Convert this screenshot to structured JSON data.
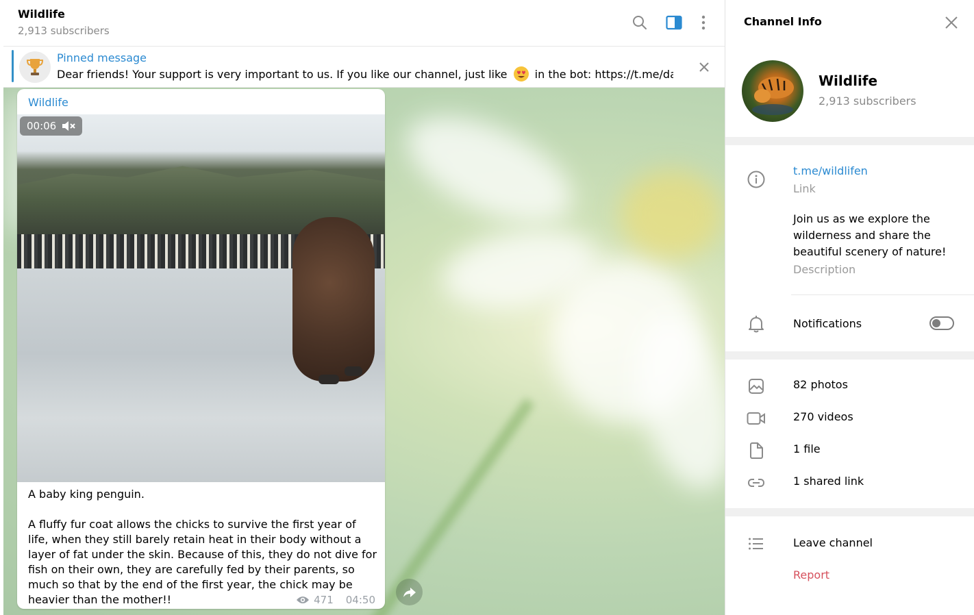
{
  "chat": {
    "title": "Wildlife",
    "subtitle": "2,913 subscribers"
  },
  "pinned": {
    "title": "Pinned message",
    "text_before": "Dear friends! Your support is very important to us.  If you like our channel, just like ",
    "text_after": " in the bot: https://t.me/dailych…"
  },
  "message": {
    "author": "Wildlife",
    "video_duration": "00:06",
    "text": "A baby king penguin.\n\nA fluffy fur coat allows the chicks to survive the first year of life, when they still barely retain heat in their body without a layer of fat under the skin. Because of this, they do not dive for fish on their own, they are carefully fed by their parents, so much so that by the end of the first year, the chick may be heavier than the mother!!",
    "views": "471",
    "time": "04:50"
  },
  "info": {
    "title": "Channel Info",
    "name": "Wildlife",
    "subscribers": "2,913 subscribers",
    "link": "t.me/wildlifen",
    "link_label": "Link",
    "description": "Join us as we explore the wilderness and share the beautiful scenery of nature!",
    "description_label": "Description",
    "notifications_label": "Notifications",
    "notifications_on": false,
    "media": {
      "photos": "82 photos",
      "videos": "270 videos",
      "files": "1 file",
      "links": "1 shared link"
    },
    "leave": "Leave channel",
    "report": "Report"
  },
  "colors": {
    "accent": "#2b8ad1",
    "danger": "#d6515d",
    "muted": "#8a8a8a"
  }
}
